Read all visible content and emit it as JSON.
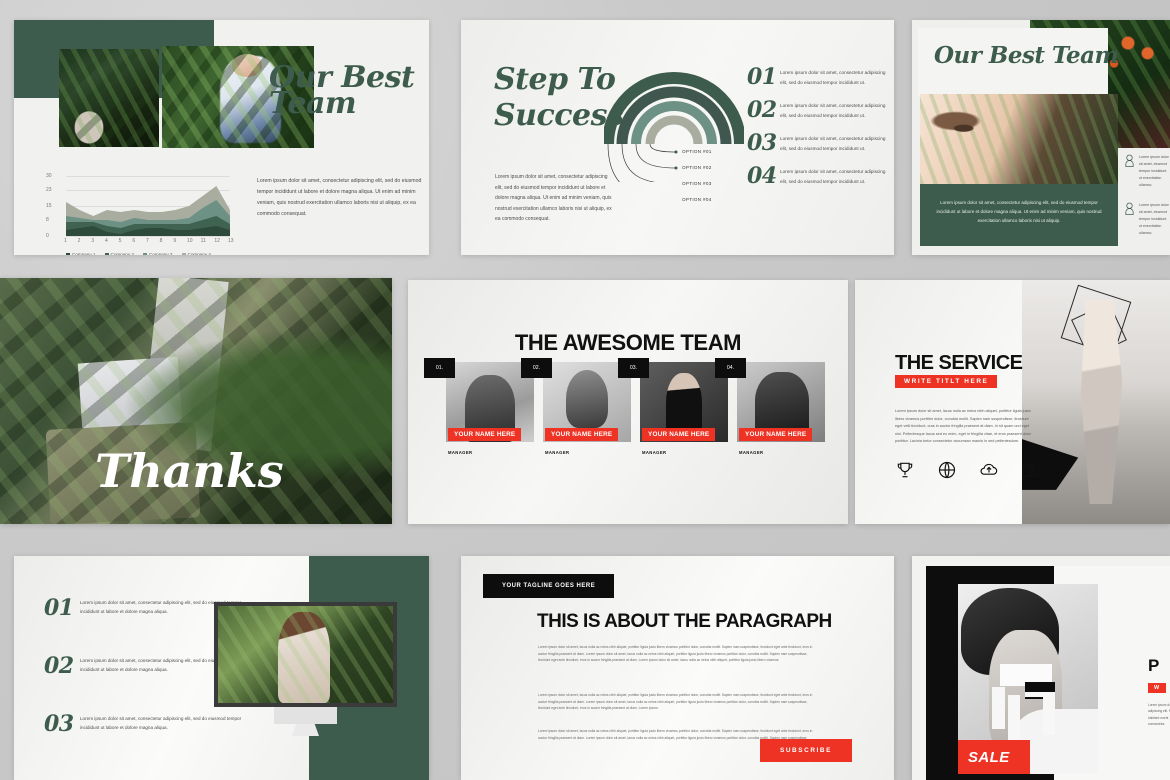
{
  "theme": {
    "green": "#3d5c4d",
    "red": "#ee3224",
    "black": "#0d0d0d",
    "page_bg": "#c8c8c8"
  },
  "slide1": {
    "title": "Our Best Team",
    "body": "Lorem ipsum dolor sit amet, consectetur adipiscing elit, sed do eiusmod tempor incididunt ut labore et dolore magna aliqua. Ut enim ad minim veniam, quis nostrud exercitation ullamco laboris nisi ut aliquip, ex ea commodo consequat.",
    "chart_data": {
      "type": "area",
      "title": "",
      "xlabel": "",
      "ylabel": "",
      "grid": true,
      "legend_position": "bottom",
      "x": [
        1,
        2,
        3,
        4,
        5,
        6,
        7,
        8,
        9,
        10,
        11,
        12,
        13
      ],
      "yticks": [
        0,
        8,
        15,
        23,
        30
      ],
      "ylim": [
        0,
        30
      ],
      "series": [
        {
          "name": "Company 1",
          "color": "#2d4a3b",
          "values": [
            3,
            4,
            5,
            2,
            1,
            3,
            4,
            4,
            3,
            3,
            4,
            5,
            3
          ]
        },
        {
          "name": "Company 2",
          "color": "#3f6350",
          "values": [
            4,
            3,
            2,
            3,
            3,
            3,
            2,
            2,
            3,
            3,
            4,
            5,
            3
          ]
        },
        {
          "name": "Company 3",
          "color": "#6d9184",
          "values": [
            3,
            2,
            1,
            3,
            3,
            3,
            2,
            2,
            2,
            3,
            6,
            8,
            4
          ]
        },
        {
          "name": "Company 4",
          "color": "#a8ad9f",
          "values": [
            7,
            4,
            2,
            5,
            5,
            4,
            4,
            4,
            5,
            6,
            6,
            7,
            3
          ]
        }
      ]
    }
  },
  "slide2": {
    "title": "Step To Success",
    "paragraph": "Lorem ipsum dolor sit amet, consectetur adipiscing elit, sed do eiusmod tempor incididunt ut labore et dolore magna aliqua. Ut enim ad minim veniam, quis nostrud exercitation ullamco laboris nisi ut aliquip, ex ea commodo consequat.",
    "options": [
      "OPTION #01",
      "OPTION #02",
      "OPTION #03",
      "OPTION #04"
    ],
    "arc_colors": [
      "#3d5c4d",
      "#3f574f",
      "#6d9184",
      "#a8ad9f"
    ],
    "steps": [
      {
        "num": "01",
        "text": "Lorem ipsum dolor sit amet, consectetur adipiscing elit, sed do eiusmod tempor incididunt ut."
      },
      {
        "num": "02",
        "text": "Lorem ipsum dolor sit amet, consectetur adipiscing elit, sed do eiusmod tempor incididunt ut."
      },
      {
        "num": "03",
        "text": "Lorem ipsum dolor sit amet, consectetur adipiscing elit, sed do eiusmod tempor incididunt ut."
      },
      {
        "num": "04",
        "text": "Lorem ipsum dolor sit amet, consectetur adipiscing elit, sed do eiusmod tempor incididunt ut."
      }
    ]
  },
  "slide3": {
    "title": "Our Best Team",
    "body": "Lorem ipsum dolor sit amet, consectetur adipiscing elit, sed do eiusmod tempor incididunt ut labore et dolore magna aliqua. Ut enim ad minim veniam, quis nostrud exercitation ullamco laboris nisi ut aliquip.",
    "side_items": [
      {
        "text": "Lorem ipsum dolor sit amet, eiusmod tempor incididunt ut exercitation ullamco."
      },
      {
        "text": "Lorem ipsum dolor sit amet, eiusmod tempor incididunt ut exercitation ullamco."
      }
    ]
  },
  "slide4": {
    "title": "Thanks"
  },
  "slide5": {
    "title": "THE AWESOME TEAM",
    "members": [
      {
        "num": "01.",
        "name": "YOUR NAME HERE",
        "role": "MANAGER"
      },
      {
        "num": "02.",
        "name": "YOUR NAME HERE",
        "role": "MANAGER"
      },
      {
        "num": "03.",
        "name": "YOUR NAME HERE",
        "role": "MANAGER"
      },
      {
        "num": "04.",
        "name": "YOUR NAME HERE",
        "role": "MANAGER"
      }
    ]
  },
  "slide6": {
    "title": "THE SERVICE",
    "badge": "WRITE TITLT HERE",
    "paragraph": "Lorem ipsum dolor sit amet, lacus nulla ac netus nibh aliquet, porttitor ligula justo libero vivamus porttitor dolor, conubia mollit. Sapien nam suspendisse, tincidunt eget velit tincidunt, cras in auctor fringilla praesent at diam. In sit quam orci eget nisl. Pellentesque lacus sed eu enim, eget in fringilla vitae, et eros praesent dolor porttitor. Lacinia tortor consectetur accumsan mauris in sed pellentesdum.",
    "icons": [
      "trophy-icon",
      "globe-icon",
      "cloud-upload-icon",
      "camera-icon"
    ]
  },
  "slide7": {
    "rows": [
      {
        "num": "01",
        "text": "Lorem ipsum dolor sit amet, consectetur adipiscing elit, sed do eiusmod tempor incididunt ut labore et dolore magna aliqua."
      },
      {
        "num": "02",
        "text": "Lorem ipsum dolor sit amet, consectetur adipiscing elit, sed do eiusmod tempor incididunt ut labore et dolore magna aliqua."
      },
      {
        "num": "03",
        "text": "Lorem ipsum dolor sit amet, consectetur adipiscing elit, sed do eiusmod tempor incididunt ut labore et dolore magna aliqua."
      }
    ]
  },
  "slide8": {
    "tagline": "YOUR TAGLINE GOES HERE",
    "title": "THIS IS ABOUT THE PARAGRAPH",
    "paragraphs": [
      "Lorem ipsum dolor sit amet, lacus nulla ac netus nibh aliquet, porttitor ligula justo libero vivamus porttitor dolor, conubia mollit. Sapien nam suspendisse, tincidunt eget ante tincidunt, eros in auctor fringilla praesent at diam. Lorem ipsum dolor sit amet, lacus nulla ac netus nibh aliquet, porttitor ligula justo libero vivamus porttitor dolor, conubia mollit. Sapien nam suspendisse, tincidunt eget ante tincidunt, eros in auctor fringilla praesent at diam. Lorem ipsum dolor sit amet, lacus nulla ac netus nibh aliquet, porttitor ligula justo libero vivamus.",
      "Lorem ipsum dolor sit amet, lacus nulla ac netus nibh aliquet, porttitor ligula justo libero vivamus porttitor dolor, conubia mollit. Sapien nam suspendisse, tincidunt eget ante tincidunt, eros in auctor fringilla praesent at diam. Lorem ipsum dolor sit amet, lacus nulla ac netus nibh aliquet, porttitor ligula justo libero vivamus porttitor dolor, conubia mollit. Sapien nam suspendisse, tincidunt eget ante tincidunt, eros in auctor fringilla praesent at diam. Lorem ipsum.",
      "Lorem ipsum dolor sit amet, lacus nulla ac netus nibh aliquet, porttitor ligula justo libero vivamus porttitor dolor, conubia mollit. Sapien nam suspendisse, tincidunt eget ante tincidunt, eros in auctor fringilla praesent at diam. Lorem ipsum dolor sit amet, lacus nulla ac netus nibh aliquet, porttitor ligula justo libero vivamus porttitor dolor, conubia mollit. Sapien nam suspendisse."
    ],
    "subscribe_label": "SUBSCRIBE"
  },
  "slide9": {
    "sale_label": "SALE",
    "right_title": "P",
    "right_badge": "W",
    "right_paragraph": "Lorem ipsum dolor sit amet, consectetur adipiscing elit. Nunc ut ante. Pellentesque habitant morbi. Lorem ipsum dolor sit amet, consectetur."
  }
}
